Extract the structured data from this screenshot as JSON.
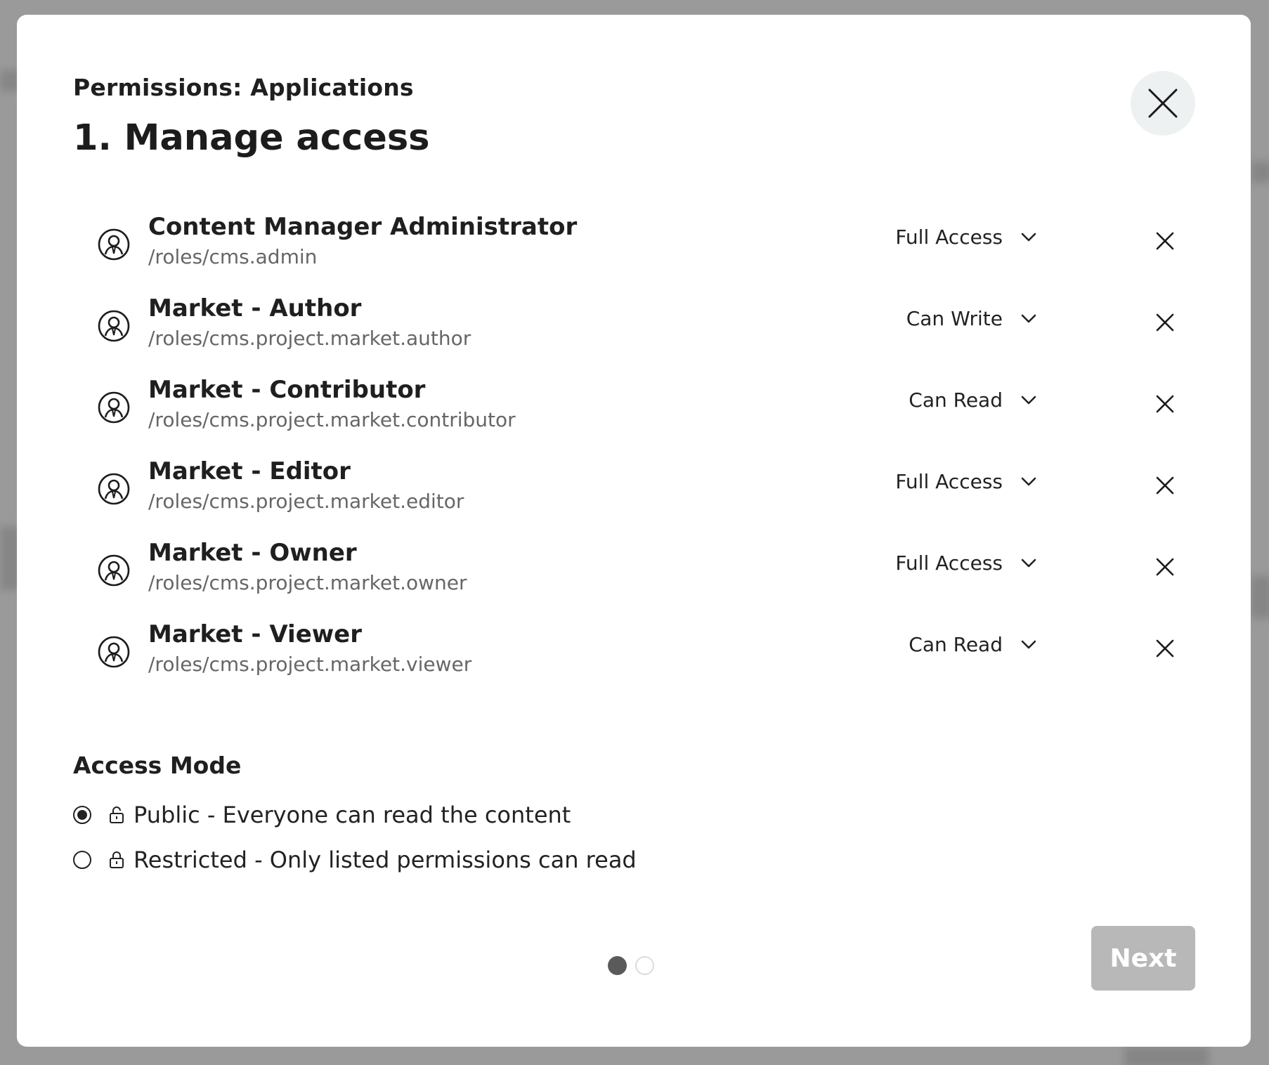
{
  "dialog": {
    "subtitle": "Permissions: Applications",
    "title": "1. Manage access",
    "close_icon": "close-icon"
  },
  "roles": [
    {
      "name": "Content Manager Administrator",
      "path": "/roles/cms.admin",
      "access": "Full Access"
    },
    {
      "name": "Market - Author",
      "path": "/roles/cms.project.market.author",
      "access": "Can Write"
    },
    {
      "name": "Market - Contributor",
      "path": "/roles/cms.project.market.contributor",
      "access": "Can Read"
    },
    {
      "name": "Market - Editor",
      "path": "/roles/cms.project.market.editor",
      "access": "Full Access"
    },
    {
      "name": "Market - Owner",
      "path": "/roles/cms.project.market.owner",
      "access": "Full Access"
    },
    {
      "name": "Market - Viewer",
      "path": "/roles/cms.project.market.viewer",
      "access": "Can Read"
    }
  ],
  "access_mode": {
    "title": "Access Mode",
    "options": [
      {
        "label": "Public - Everyone can read the content",
        "selected": true,
        "icon": "unlock-icon"
      },
      {
        "label": "Restricted - Only listed permissions can read",
        "selected": false,
        "icon": "lock-icon"
      }
    ]
  },
  "pager": {
    "current_step": 1,
    "total_steps": 2
  },
  "footer": {
    "next_label": "Next",
    "next_disabled": true
  },
  "colors": {
    "backdrop": "#9a9a9a",
    "next_disabled": "#b8b8b8",
    "pager_active": "#5a5a5a",
    "close_bg": "#eef1f1"
  }
}
